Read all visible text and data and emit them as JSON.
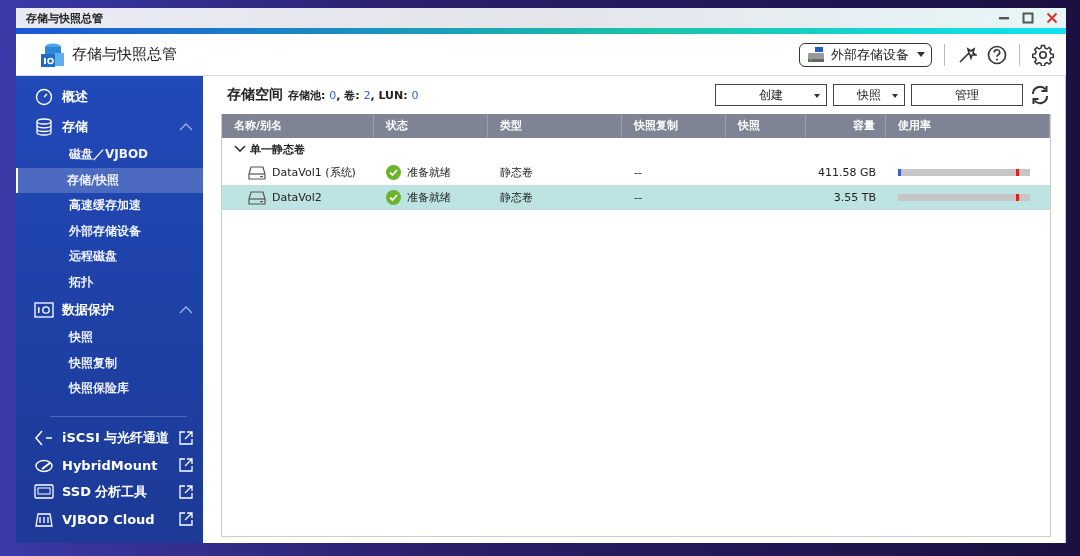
{
  "window": {
    "title": "存储与快照总管"
  },
  "header": {
    "app_title": "存储与快照总管",
    "device_menu": "外部存储设备"
  },
  "sidebar": {
    "items": [
      {
        "kind": "group",
        "label": "概述",
        "selected": false
      },
      {
        "kind": "group",
        "label": "存储",
        "selected": false,
        "expanded": true,
        "children": [
          {
            "label": "磁盘／VJBOD",
            "selected": false
          },
          {
            "label": "存储/快照",
            "selected": true
          },
          {
            "label": "高速缓存加速",
            "selected": false
          },
          {
            "label": "外部存储设备",
            "selected": false
          },
          {
            "label": "远程磁盘",
            "selected": false
          },
          {
            "label": "拓扑",
            "selected": false
          }
        ]
      },
      {
        "kind": "group",
        "label": "数据保护",
        "selected": false,
        "expanded": true,
        "children": [
          {
            "label": "快照",
            "selected": false
          },
          {
            "label": "快照复制",
            "selected": false
          },
          {
            "label": "快照保险库",
            "selected": false
          }
        ]
      },
      {
        "kind": "divider"
      },
      {
        "kind": "external",
        "label": "iSCSI 与光纤通道",
        "selected": false
      },
      {
        "kind": "external",
        "label": "HybridMount",
        "selected": false
      },
      {
        "kind": "external",
        "label": "SSD 分析工具",
        "selected": false
      },
      {
        "kind": "external",
        "label": "VJBOD Cloud",
        "selected": false
      }
    ]
  },
  "content": {
    "title": "存储空间",
    "summary": [
      {
        "label": "存储池: ",
        "value": "0"
      },
      {
        "label": ", 卷: ",
        "value": "2"
      },
      {
        "label": ", LUN: ",
        "value": "0"
      }
    ],
    "buttons": [
      {
        "label": "创建",
        "dropdown": true
      },
      {
        "label": "快照",
        "dropdown": true
      },
      {
        "label": "管理",
        "dropdown": false
      }
    ]
  },
  "table": {
    "columns": [
      "名称/别名",
      "状态",
      "类型",
      "快照复制",
      "快照",
      "容量",
      "使用率"
    ],
    "groups": [
      {
        "label": "单一静态卷",
        "expanded": true,
        "rows": [
          {
            "name": "DataVol1 (系统)",
            "status": "准备就绪",
            "type": "静态卷",
            "replication": "--",
            "capacity": "411.58 GB",
            "level": 0.02,
            "selected": false
          },
          {
            "name": "DataVol2",
            "status": "准备就绪",
            "type": "静态卷",
            "replication": "--",
            "capacity": "3.55 TB",
            "level": 0,
            "selected": true
          }
        ]
      }
    ]
  }
}
